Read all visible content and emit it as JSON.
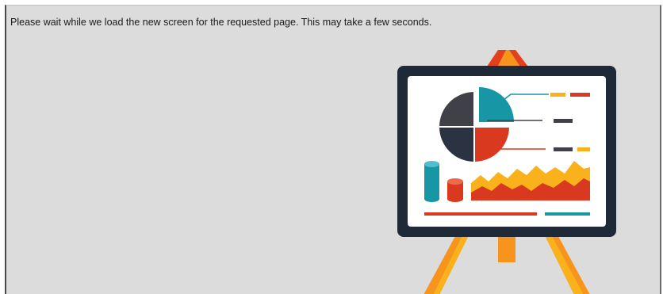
{
  "loading": {
    "message": "Please wait while we load the new screen for the requested page. This may take a few seconds."
  },
  "illustration": {
    "icon": "presentation-easel-icon",
    "colors": {
      "background": "#dcdcdc",
      "board": "#1f2a38",
      "board_face": "#ffffff",
      "easel_orange": "#f7941d",
      "easel_red": "#e2401f",
      "teal": "#1797a6",
      "red": "#d8391f",
      "yellow": "#f9b21b",
      "dark_gray": "#404048"
    }
  }
}
